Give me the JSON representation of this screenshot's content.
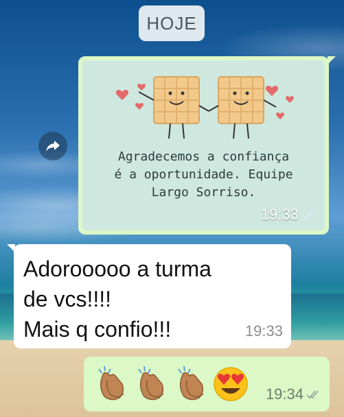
{
  "date_chip": "HOJE",
  "image_message": {
    "caption_lines": [
      "Agradecemos a confiança",
      "é a oportunidade. Equipe",
      "Largo Sorriso."
    ],
    "time": "19:33",
    "status": "read"
  },
  "incoming_message": {
    "text": "Adorooooo a turma\nde vcs!!!!\nMais q confio!!!",
    "time": "19:33"
  },
  "outgoing_message": {
    "emojis": [
      "clapping-hands",
      "clapping-hands",
      "clapping-hands",
      "heart-eyes-face"
    ],
    "time": "19:34",
    "status": "read"
  },
  "colors": {
    "outgoing_bubble": "#dcf8c6",
    "incoming_bubble": "#ffffff",
    "read_tick": "#8fb6d8"
  }
}
